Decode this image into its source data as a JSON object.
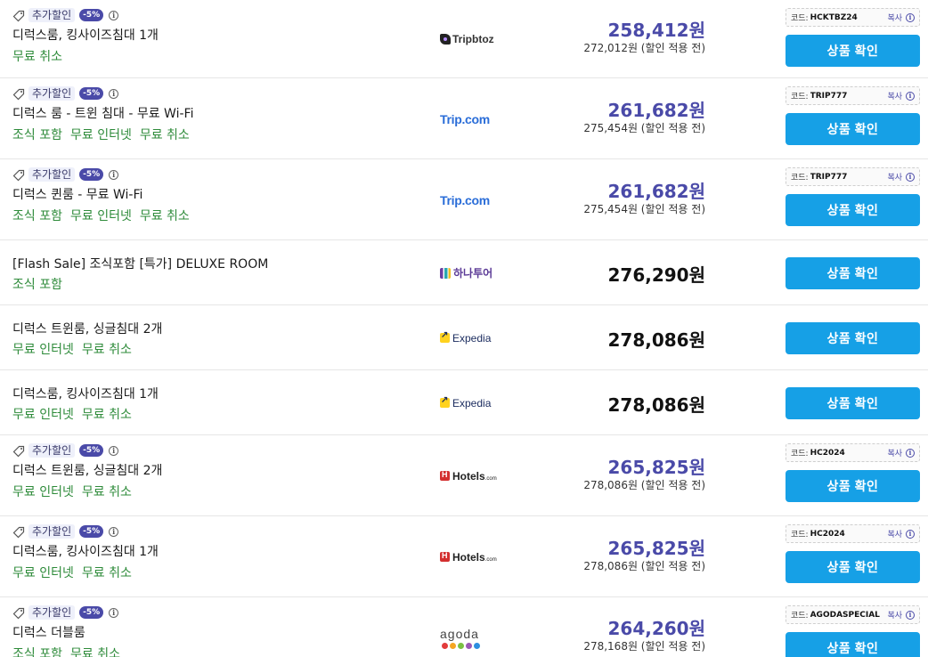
{
  "ui": {
    "promo_label": "추가할인",
    "discount_badge": "-5%",
    "code_label": "코드:",
    "copy_label": "복사",
    "cta_label": "상품 확인",
    "before_discount_suffix": "(할인 적용 전)"
  },
  "offers": [
    {
      "promo": true,
      "room": "디럭스룸, 킹사이즈침대 1개",
      "amenities": [
        "무료 취소"
      ],
      "provider": "Tripbtoz",
      "price": "258,412원",
      "original_price": "272,012원",
      "code": "HCKTBZ24"
    },
    {
      "promo": true,
      "room": "디럭스 룸 - 트윈 침대 - 무료 Wi-Fi",
      "amenities": [
        "조식 포함",
        "무료 인터넷",
        "무료 취소"
      ],
      "provider": "Trip.com",
      "price": "261,682원",
      "original_price": "275,454원",
      "code": "TRIP777"
    },
    {
      "promo": true,
      "room": "디럭스 퀸룸 - 무료 Wi-Fi",
      "amenities": [
        "조식 포함",
        "무료 인터넷",
        "무료 취소"
      ],
      "provider": "Trip.com",
      "price": "261,682원",
      "original_price": "275,454원",
      "code": "TRIP777"
    },
    {
      "promo": false,
      "room": "[Flash Sale] 조식포함 [특가] DELUXE ROOM",
      "amenities": [
        "조식 포함"
      ],
      "provider": "하나투어",
      "price": "276,290원"
    },
    {
      "promo": false,
      "room": "디럭스 트윈룸, 싱글침대 2개",
      "amenities": [
        "무료 인터넷",
        "무료 취소"
      ],
      "provider": "Expedia",
      "price": "278,086원"
    },
    {
      "promo": false,
      "room": "디럭스룸, 킹사이즈침대 1개",
      "amenities": [
        "무료 인터넷",
        "무료 취소"
      ],
      "provider": "Expedia",
      "price": "278,086원"
    },
    {
      "promo": true,
      "room": "디럭스 트윈룸, 싱글침대 2개",
      "amenities": [
        "무료 인터넷",
        "무료 취소"
      ],
      "provider": "Hotels",
      "provider_suffix": ".com",
      "price": "265,825원",
      "original_price": "278,086원",
      "code": "HC2024"
    },
    {
      "promo": true,
      "room": "디럭스룸, 킹사이즈침대 1개",
      "amenities": [
        "무료 인터넷",
        "무료 취소"
      ],
      "provider": "Hotels",
      "provider_suffix": ".com",
      "price": "265,825원",
      "original_price": "278,086원",
      "code": "HC2024"
    },
    {
      "promo": true,
      "room": "디럭스 더블룸",
      "amenities": [
        "조식 포함",
        "무료 취소"
      ],
      "provider": "agoda",
      "price": "264,260원",
      "original_price": "278,168원",
      "code": "AGODASPECIAL"
    }
  ],
  "colors": {
    "accent_price": "#4a4aa8",
    "cta_blue": "#16a0e6",
    "amenity_green": "#2e8b3a"
  }
}
